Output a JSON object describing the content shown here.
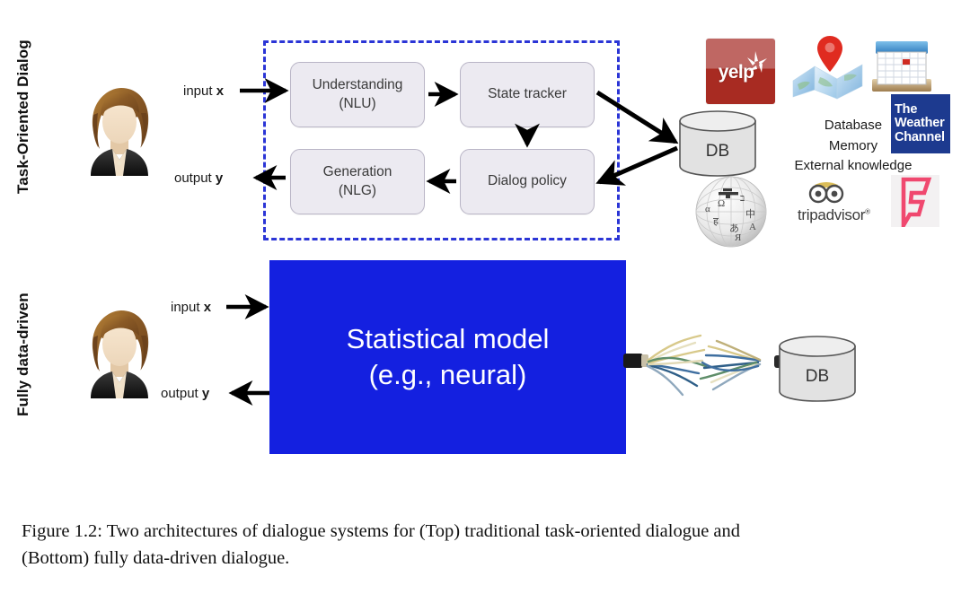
{
  "figure": {
    "sections": {
      "top_label": "Task-Oriented Dialog",
      "bottom_label": "Fully data-driven"
    },
    "io": {
      "input_label_prefix": "input ",
      "input_var": "x",
      "output_label_prefix": "output ",
      "output_var": "y"
    },
    "top_pipeline": {
      "modules": [
        {
          "line1": "Understanding",
          "line2": "(NLU)"
        },
        {
          "line1": "State tracker",
          "line2": ""
        },
        {
          "line1": "Dialog policy",
          "line2": ""
        },
        {
          "line1": "Generation",
          "line2": "(NLG)"
        }
      ],
      "db_label": "DB"
    },
    "knowledge": {
      "lines": [
        "Database",
        "Memory",
        "External knowledge"
      ],
      "logos": [
        {
          "name": "yelp",
          "text": "yelp"
        },
        {
          "name": "maps",
          "text": ""
        },
        {
          "name": "calendar",
          "text": ""
        },
        {
          "name": "weather-channel",
          "line1": "The",
          "line2": "Weather",
          "line3": "Channel"
        },
        {
          "name": "wikipedia",
          "text": ""
        },
        {
          "name": "tripadvisor",
          "text": "tripadvisor",
          "mark": "®"
        },
        {
          "name": "foursquare",
          "text": ""
        }
      ]
    },
    "bottom_pipeline": {
      "model_line1": "Statistical model",
      "model_line2": "(e.g., neural)",
      "db_label": "DB"
    },
    "caption": {
      "line1": "Figure 1.2:  Two architectures of dialogue systems for (Top) traditional task-oriented dialogue and",
      "line2": "(Bottom) fully data-driven dialogue."
    },
    "colors": {
      "dashed_border": "#2b35d6",
      "model_fill": "#1420e0",
      "module_fill": "#eceaf1",
      "yelp_red": "#a82b22",
      "weather_navy": "#1d3a8f",
      "foursquare_pink": "#f0486f"
    }
  }
}
